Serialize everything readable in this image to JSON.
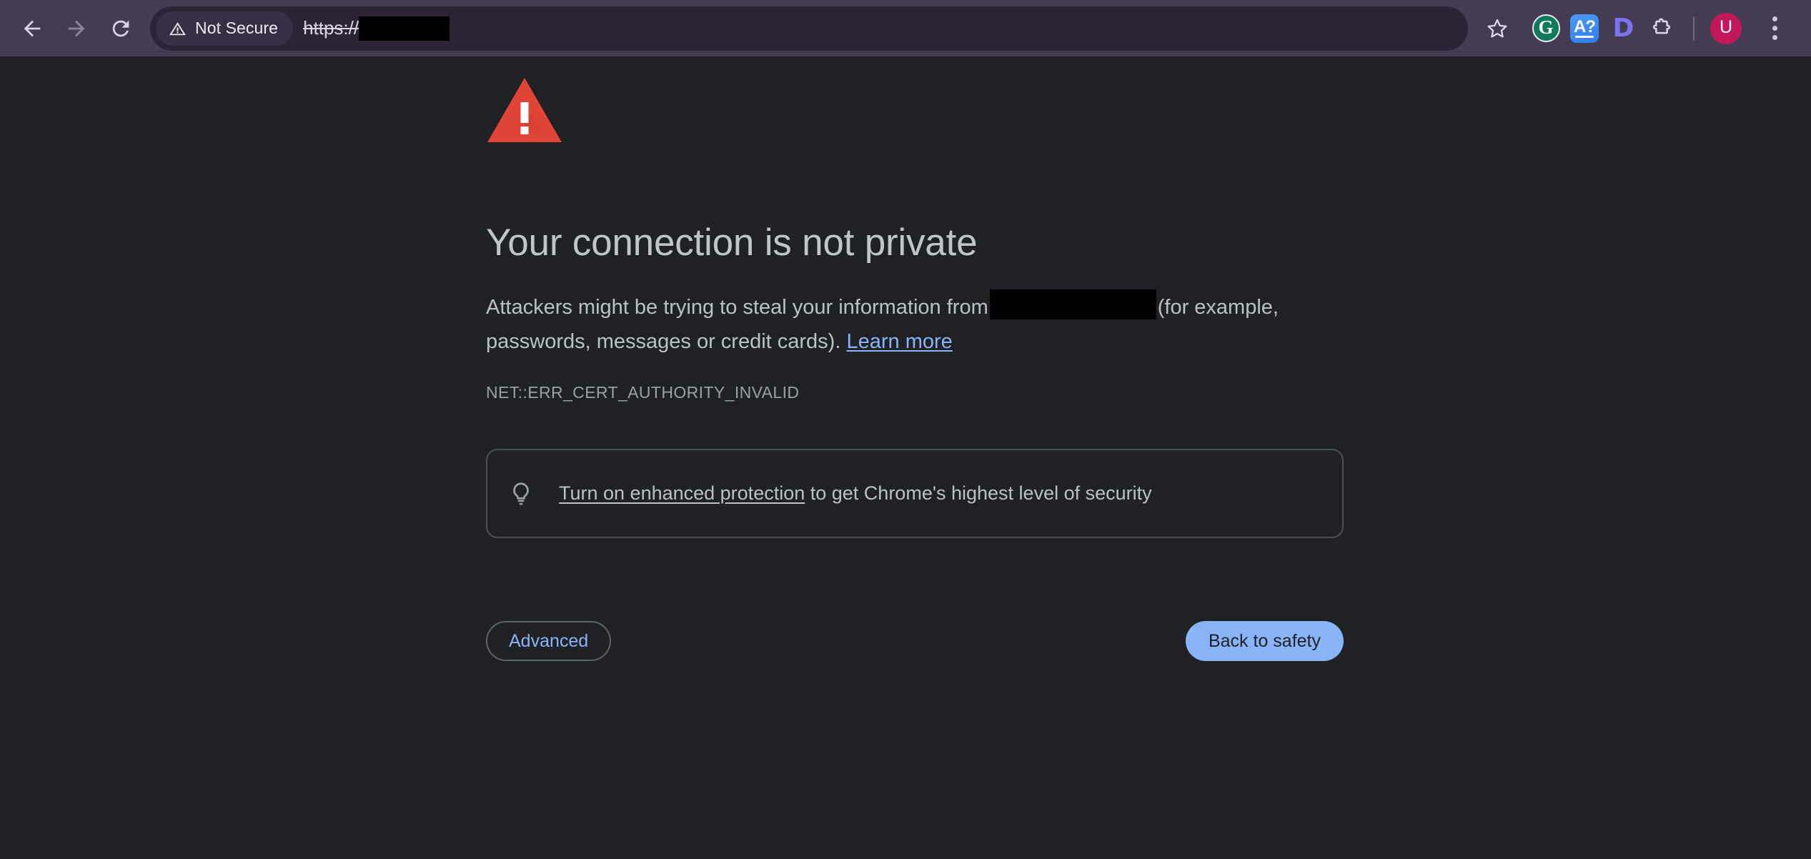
{
  "browser": {
    "nav": {
      "back_label": "Back",
      "forward_label": "Forward",
      "reload_label": "Reload"
    },
    "omnibox": {
      "security_badge": "Not Secure",
      "security_icon": "warning-triangle-icon",
      "url_scheme": "https://",
      "url_host_redacted": true
    },
    "actions": [
      {
        "name": "bookmark-star-icon",
        "label": "Bookmark this tab"
      },
      {
        "name": "grammarly-extension-icon",
        "label": "G"
      },
      {
        "name": "dictionary-extension-icon",
        "label": "A?"
      },
      {
        "name": "d-extension-icon",
        "label": "D"
      },
      {
        "name": "extensions-puzzle-icon",
        "label": "Extensions"
      }
    ],
    "profile": {
      "initial": "U",
      "color": "#C2185B"
    },
    "menu_label": "Customize and control Google Chrome"
  },
  "interstitial": {
    "icon": "red-warning-triangle-icon",
    "heading": "Your connection is not private",
    "body_part1": "Attackers might be trying to steal your information from",
    "body_host_redacted": true,
    "body_part2": "(for example, passwords, messages or credit cards).",
    "learn_more": "Learn more",
    "error_code": "NET::ERR_CERT_AUTHORITY_INVALID",
    "enhanced_protection": {
      "icon": "lightbulb-icon",
      "link_text": "Turn on enhanced protection",
      "rest_text": " to get Chrome's highest level of security"
    },
    "advanced_button": "Advanced",
    "back_to_safety_button": "Back to safety"
  },
  "colors": {
    "page_bg": "#202124",
    "toolbar_bg": "#443C52",
    "omnibox_bg": "#2C2436",
    "warning_red": "#E04437",
    "link_blue": "#8AB4F8",
    "text_gray": "#BDC1C6"
  }
}
